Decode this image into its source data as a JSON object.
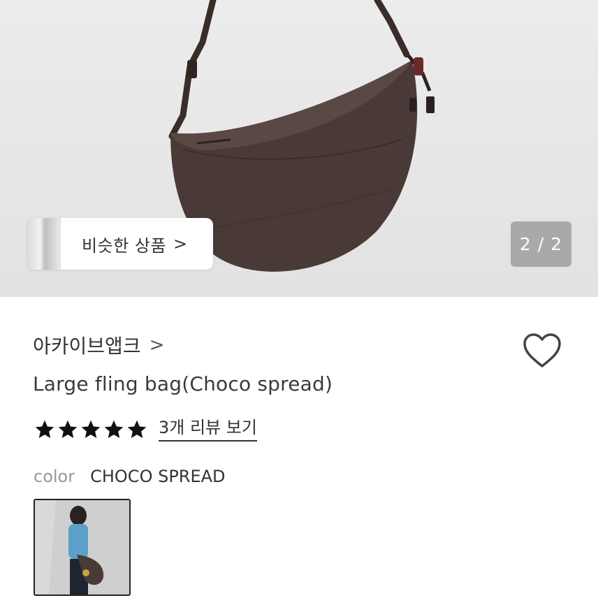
{
  "gallery": {
    "similar_button_label": "비슷한 상품",
    "similar_chevron": ">",
    "counter_text": "2 / 2"
  },
  "product": {
    "brand": "아카이브앱크",
    "brand_chevron": ">",
    "title": "Large fling bag(Choco spread)",
    "rating_stars": 5,
    "review_link": "3개 리뷰 보기",
    "option_label": "color",
    "option_value": "CHOCO SPREAD"
  },
  "colors": {
    "bag": "#4a3a37",
    "star": "#111111",
    "counter_bg": "#a9a9a9"
  }
}
